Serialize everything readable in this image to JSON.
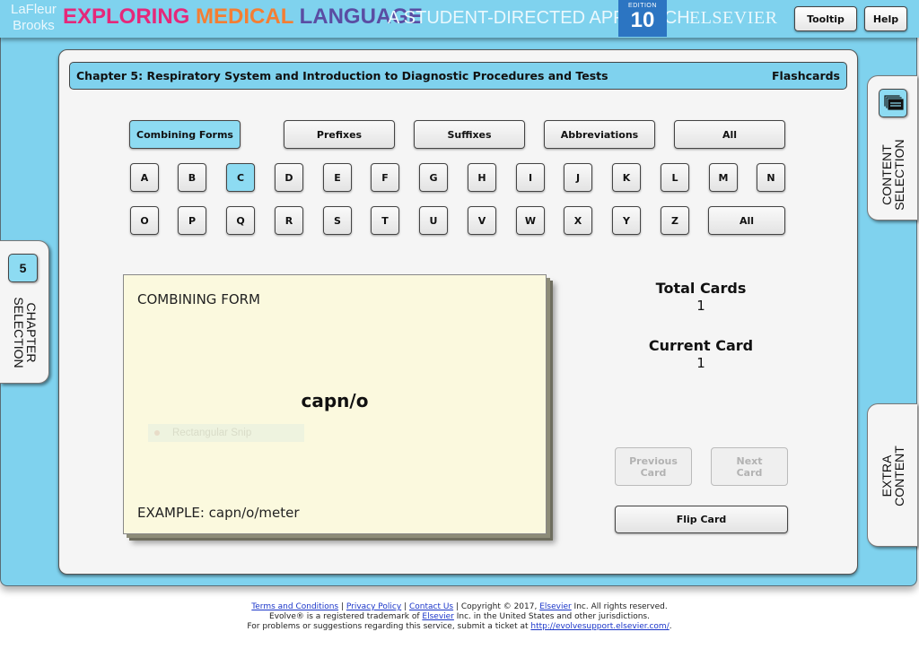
{
  "header": {
    "author_line1": "LaFleur",
    "author_line2": "Brooks",
    "title_part1": "EXPLORING",
    "title_part2": "MEDICAL",
    "title_part3": "LANGUAGE",
    "subtitle": "A STUDENT-DIRECTED APPROACH",
    "edition_label": "EDITION",
    "edition_number": "10",
    "publisher": "ELSEVIER",
    "tooltip_label": "Tooltip",
    "help_label": "Help"
  },
  "chapter_bar": {
    "title": "Chapter 5: Respiratory System and Introduction to Diagnostic Procedures and Tests",
    "mode": "Flashcards"
  },
  "categories": [
    {
      "label": "Combining Forms",
      "active": true
    },
    {
      "label": "Prefixes",
      "active": false
    },
    {
      "label": "Suffixes",
      "active": false
    },
    {
      "label": "Abbreviations",
      "active": false
    },
    {
      "label": "All",
      "active": false
    }
  ],
  "letters_row1": [
    "A",
    "B",
    "C",
    "D",
    "E",
    "F",
    "G",
    "H",
    "I",
    "J",
    "K",
    "L",
    "M",
    "N"
  ],
  "letters_row2": [
    "O",
    "P",
    "Q",
    "R",
    "S",
    "T",
    "U",
    "V",
    "W",
    "X",
    "Y",
    "Z"
  ],
  "letters_all_label": "All",
  "selected_letter": "C",
  "card": {
    "type": "COMBINING FORM",
    "term": "capn/o",
    "example": "EXAMPLE: capn/o/meter",
    "ghost_overlay": "Rectangular Snip"
  },
  "stats": {
    "total_label": "Total Cards",
    "total_value": "1",
    "current_label": "Current Card",
    "current_value": "1"
  },
  "nav": {
    "previous_line1": "Previous",
    "previous_line2": "Card",
    "next_line1": "Next",
    "next_line2": "Card",
    "flip_label": "Flip Card"
  },
  "side_tabs": {
    "chapter_number": "5",
    "chapter_line1": "CHAPTER",
    "chapter_line2": "SELECTION",
    "content_line1": "CONTENT",
    "content_line2": "SELECTION",
    "extra_line1": "EXTRA",
    "extra_line2": "CONTENT"
  },
  "footer": {
    "terms": "Terms and Conditions",
    "sep": " | ",
    "privacy": "Privacy Policy",
    "contact": "Contact Us",
    "copyright_pre": " | Copyright © 2017, ",
    "elsevier": "Elsevier",
    "copyright_post": " Inc. All rights reserved.",
    "tm_pre": "Evolve® is a registered trademark of ",
    "tm_post": " Inc. in the United States and other jurisdictions.",
    "support_pre": "For problems or suggestions regarding this service, submit a ticket at ",
    "support_link": "http://evolvesupport.elsevier.com/",
    "support_post": "."
  }
}
